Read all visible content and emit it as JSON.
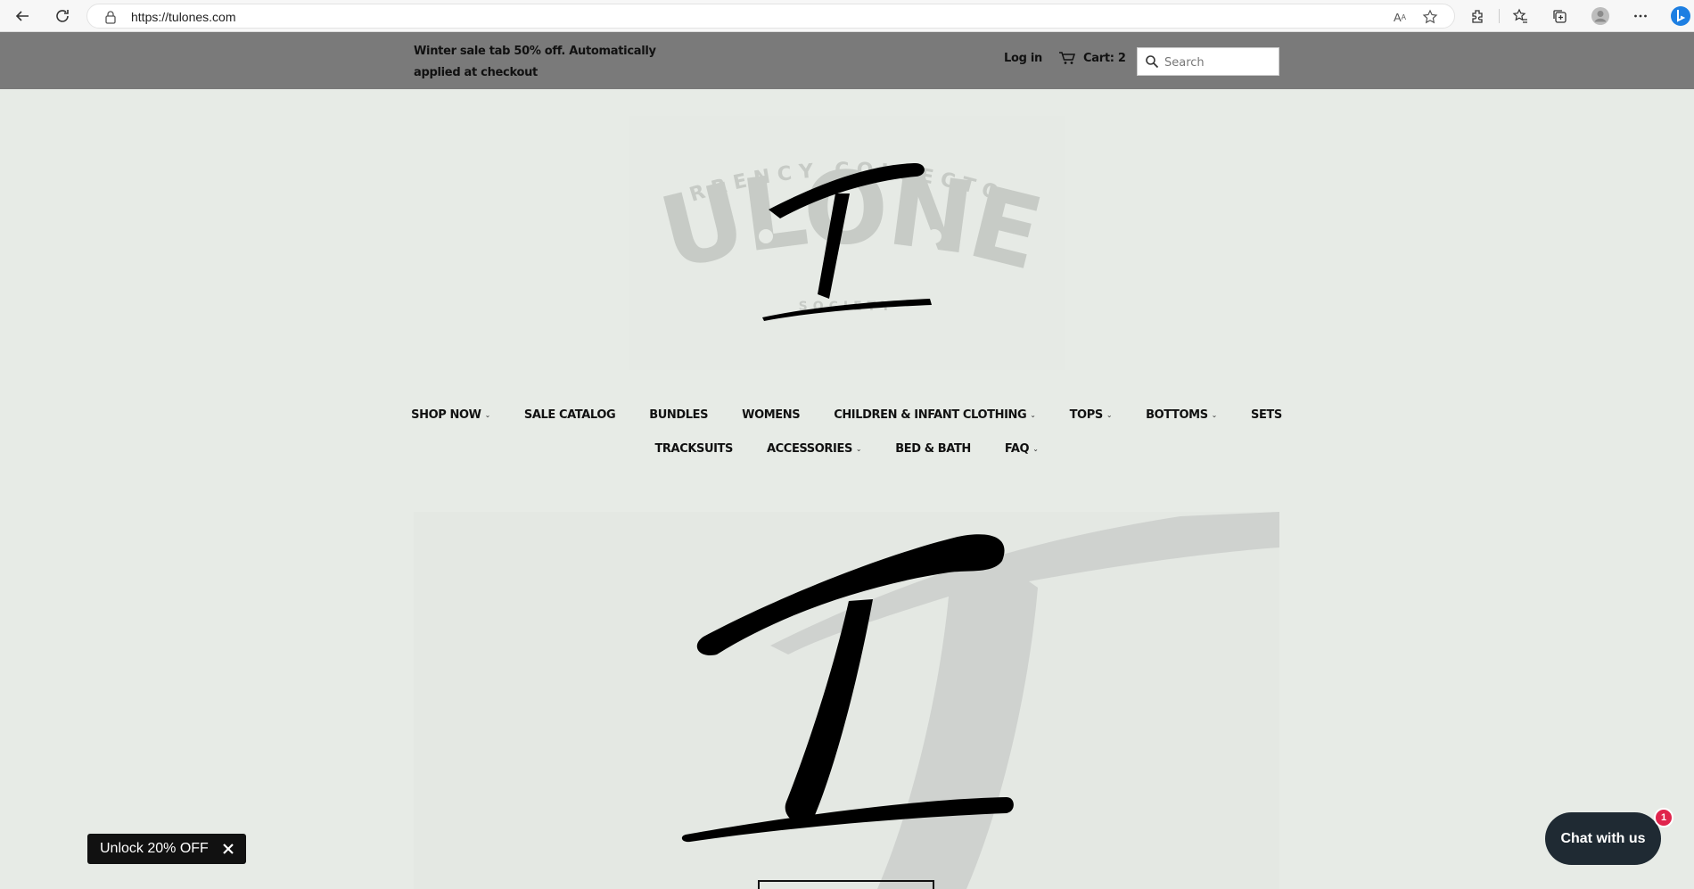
{
  "browser": {
    "url": "https://tulones.com"
  },
  "announcement": {
    "message": "Winter sale tab 50% off. Automatically applied at checkout",
    "login_label": "Log in",
    "cart_label": "Cart: 2"
  },
  "search": {
    "placeholder": "Search"
  },
  "logo": {
    "text_top": "CURRENCY COLLECTORS",
    "text_main": "TULONES",
    "text_bottom": "SOCIETY"
  },
  "nav": {
    "row1": [
      {
        "label": "SHOP NOW",
        "dropdown": true
      },
      {
        "label": "SALE CATALOG",
        "dropdown": false
      },
      {
        "label": "BUNDLES",
        "dropdown": false
      },
      {
        "label": "WOMENS",
        "dropdown": false
      },
      {
        "label": "CHILDREN & INFANT CLOTHING",
        "dropdown": true
      },
      {
        "label": "TOPS",
        "dropdown": true
      },
      {
        "label": "BOTTOMS",
        "dropdown": true
      },
      {
        "label": "SETS",
        "dropdown": false
      }
    ],
    "row2": [
      {
        "label": "TRACKSUITS",
        "dropdown": false
      },
      {
        "label": "ACCESSORIES",
        "dropdown": true
      },
      {
        "label": "BED & BATH",
        "dropdown": false
      },
      {
        "label": "FAQ",
        "dropdown": true
      }
    ]
  },
  "popups": {
    "unlock_label": "Unlock 20% OFF",
    "chat_label": "Chat with us",
    "chat_badge": "1"
  },
  "colors": {
    "announce_bg": "#7a7a7a",
    "page_bg": "#e7ebe6",
    "chat_bg": "#1f2a33",
    "badge": "#e0244c"
  }
}
